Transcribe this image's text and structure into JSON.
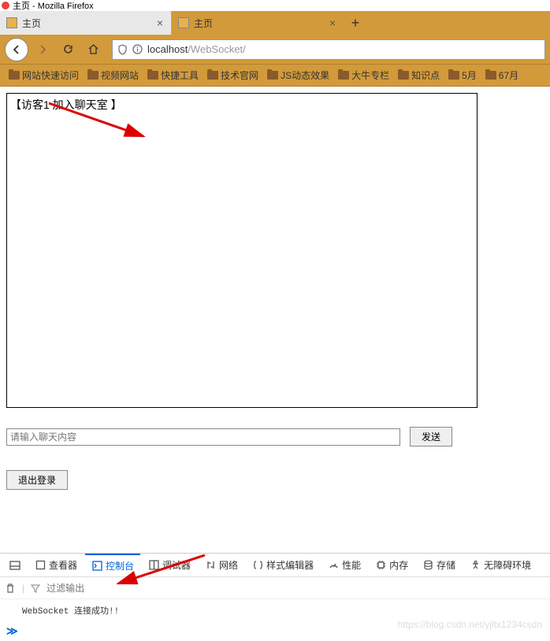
{
  "window": {
    "title": "主页 - Mozilla Firefox"
  },
  "tabs": [
    {
      "title": "主页",
      "active": false
    },
    {
      "title": "主页",
      "active": true
    }
  ],
  "nav": {
    "url_prefix": "localhost",
    "url_suffix": "/WebSocket/"
  },
  "bookmarks": [
    {
      "label": "网站快速访问"
    },
    {
      "label": "视频网站"
    },
    {
      "label": "快捷工具"
    },
    {
      "label": "技术官网"
    },
    {
      "label": "JS动态效果"
    },
    {
      "label": "大牛专栏"
    },
    {
      "label": "知识点"
    },
    {
      "label": "5月"
    },
    {
      "label": "67月"
    }
  ],
  "chat": {
    "message": "【访客1 加入聊天室 】",
    "input_placeholder": "请输入聊天内容",
    "send_label": "发送",
    "logout_label": "退出登录"
  },
  "devtools": {
    "tabs": [
      {
        "key": "inspector",
        "label": "查看器"
      },
      {
        "key": "console",
        "label": "控制台",
        "active": true
      },
      {
        "key": "debugger",
        "label": "调试器"
      },
      {
        "key": "network",
        "label": "网络"
      },
      {
        "key": "style",
        "label": "样式编辑器"
      },
      {
        "key": "performance",
        "label": "性能"
      },
      {
        "key": "memory",
        "label": "内存"
      },
      {
        "key": "storage",
        "label": "存储"
      },
      {
        "key": "accessibility",
        "label": "无障碍环境"
      }
    ],
    "filter_placeholder": "过滤输出",
    "console_message": "WebSocket 连接成功!!"
  },
  "watermark": "https://blog.csdn.net/yjltx1234csdn"
}
